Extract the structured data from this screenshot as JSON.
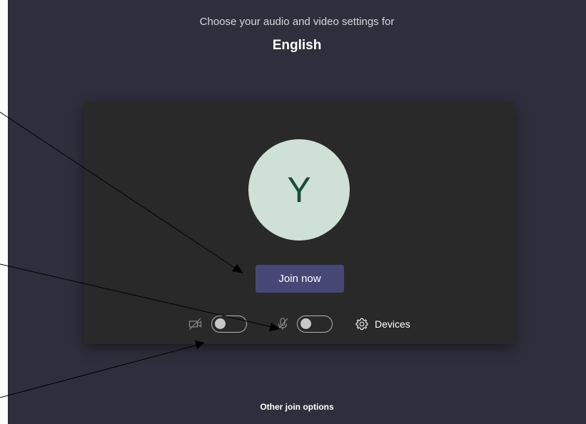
{
  "prejoin": {
    "heading": "Choose your audio and video settings for",
    "meeting_name": "English",
    "avatar_initial": "Y",
    "join_label": "Join now",
    "camera_state": "off",
    "mic_state": "off",
    "devices_label": "Devices",
    "other_options_label": "Other join options"
  },
  "colors": {
    "background": "#2f2e3c",
    "card": "#292929",
    "avatar": "#cfe0d6",
    "avatar_text": "#1a4d3a",
    "join_button": "#464775"
  },
  "icons": {
    "camera": "camera-off-icon",
    "mic": "mic-off-icon",
    "devices": "gear-icon"
  }
}
